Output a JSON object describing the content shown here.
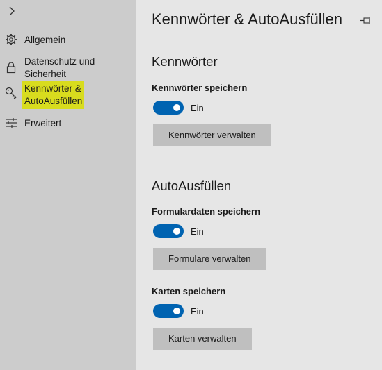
{
  "sidebar": {
    "items": [
      {
        "label": "Allgemein",
        "icon": "gear-icon"
      },
      {
        "label_line1": "Datenschutz und",
        "label_line2": "Sicherheit",
        "icon": "lock-icon"
      },
      {
        "label_line1": "Kennwörter &",
        "label_line2": "AutoAusfüllen",
        "icon": "key-icon",
        "highlight_color": "#d8dc1e"
      },
      {
        "label": "Erweitert",
        "icon": "sliders-icon"
      }
    ]
  },
  "main": {
    "title": "Kennwörter & AutoAusfüllen",
    "sections": [
      {
        "title": "Kennwörter",
        "settings": [
          {
            "label": "Kennwörter speichern",
            "state": "Ein",
            "button": "Kennwörter verwalten"
          }
        ]
      },
      {
        "title": "AutoAusfüllen",
        "settings": [
          {
            "label": "Formulardaten speichern",
            "state": "Ein",
            "button": "Formulare verwalten"
          },
          {
            "label": "Karten speichern",
            "state": "Ein",
            "button": "Karten verwalten"
          }
        ]
      }
    ]
  },
  "colors": {
    "accent": "#0063b1",
    "sidebar_bg": "#cccccc",
    "main_bg": "#e6e6e6",
    "button_bg": "#bfbfbf"
  }
}
